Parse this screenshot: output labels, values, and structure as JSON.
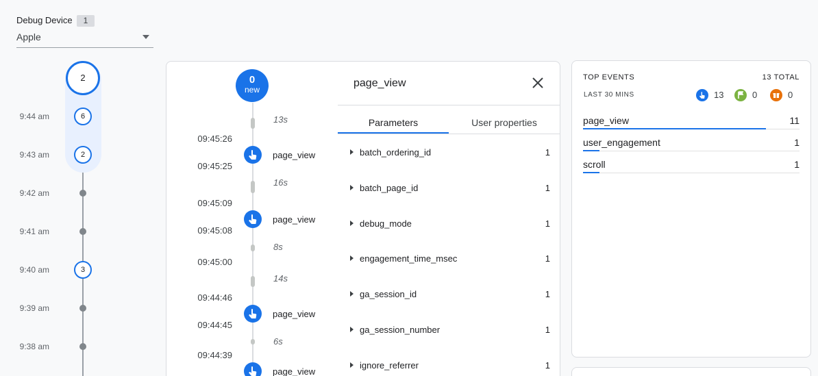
{
  "debug_device": {
    "label": "Debug Device",
    "count": "1",
    "selected": "Apple"
  },
  "minutes": {
    "current_count": "2",
    "rows": [
      {
        "time": "9:44 am",
        "count": "6"
      },
      {
        "time": "9:43 am",
        "count": "2"
      },
      {
        "time": "9:42 am",
        "count": ""
      },
      {
        "time": "9:41 am",
        "count": ""
      },
      {
        "time": "9:40 am",
        "count": "3"
      },
      {
        "time": "9:39 am",
        "count": ""
      },
      {
        "time": "9:38 am",
        "count": ""
      }
    ]
  },
  "stream": {
    "new_count": "0",
    "new_label": "new",
    "gaps": [
      "13s",
      "16s",
      "8s",
      "14s",
      "6s"
    ],
    "timestamps": [
      "09:45:26",
      "09:45:25",
      "09:45:09",
      "09:45:08",
      "09:45:00",
      "09:44:46",
      "09:44:45",
      "09:44:39"
    ],
    "events": [
      {
        "name": "page_view",
        "icon": "touch-icon"
      },
      {
        "name": "page_view",
        "icon": "touch-icon"
      },
      {
        "name": "page_view",
        "icon": "touch-icon"
      },
      {
        "name": "page_view",
        "icon": "touch-icon"
      }
    ]
  },
  "detail": {
    "title": "page_view",
    "tabs": [
      "Parameters",
      "User properties"
    ],
    "active_tab": "Parameters",
    "parameters": [
      {
        "name": "batch_ordering_id",
        "value": "1"
      },
      {
        "name": "batch_page_id",
        "value": "1"
      },
      {
        "name": "debug_mode",
        "value": "1"
      },
      {
        "name": "engagement_time_msec",
        "value": "1"
      },
      {
        "name": "ga_session_id",
        "value": "1"
      },
      {
        "name": "ga_session_number",
        "value": "1"
      },
      {
        "name": "ignore_referrer",
        "value": "1"
      }
    ]
  },
  "top_events": {
    "title": "TOP EVENTS",
    "total": "13 TOTAL",
    "period": "LAST 30 MINS",
    "stats": [
      {
        "icon": "touch-icon",
        "color": "#1a73e8",
        "count": "13"
      },
      {
        "icon": "flag-icon",
        "color": "#7cb342",
        "count": "0"
      },
      {
        "icon": "gift-icon",
        "color": "#e8710a",
        "count": "0"
      }
    ],
    "events": [
      {
        "name": "page_view",
        "count": "11",
        "share": 0.846
      },
      {
        "name": "user_engagement",
        "count": "1",
        "share": 0.077
      },
      {
        "name": "scroll",
        "count": "1",
        "share": 0.077
      }
    ]
  },
  "colors": {
    "accent": "#1a73e8",
    "conversion": "#7cb342",
    "error": "#e8710a"
  }
}
